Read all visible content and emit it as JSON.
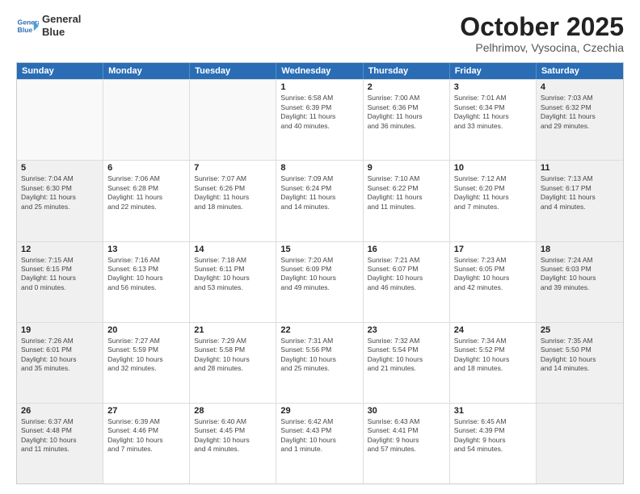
{
  "header": {
    "logo_line1": "General",
    "logo_line2": "Blue",
    "month": "October 2025",
    "location": "Pelhrimov, Vysocina, Czechia"
  },
  "weekdays": [
    "Sunday",
    "Monday",
    "Tuesday",
    "Wednesday",
    "Thursday",
    "Friday",
    "Saturday"
  ],
  "rows": [
    [
      {
        "day": "",
        "text": "",
        "empty": true
      },
      {
        "day": "",
        "text": "",
        "empty": true
      },
      {
        "day": "",
        "text": "",
        "empty": true
      },
      {
        "day": "1",
        "text": "Sunrise: 6:58 AM\nSunset: 6:39 PM\nDaylight: 11 hours\nand 40 minutes."
      },
      {
        "day": "2",
        "text": "Sunrise: 7:00 AM\nSunset: 6:36 PM\nDaylight: 11 hours\nand 36 minutes."
      },
      {
        "day": "3",
        "text": "Sunrise: 7:01 AM\nSunset: 6:34 PM\nDaylight: 11 hours\nand 33 minutes."
      },
      {
        "day": "4",
        "text": "Sunrise: 7:03 AM\nSunset: 6:32 PM\nDaylight: 11 hours\nand 29 minutes.",
        "shaded": true
      }
    ],
    [
      {
        "day": "5",
        "text": "Sunrise: 7:04 AM\nSunset: 6:30 PM\nDaylight: 11 hours\nand 25 minutes.",
        "shaded": true
      },
      {
        "day": "6",
        "text": "Sunrise: 7:06 AM\nSunset: 6:28 PM\nDaylight: 11 hours\nand 22 minutes."
      },
      {
        "day": "7",
        "text": "Sunrise: 7:07 AM\nSunset: 6:26 PM\nDaylight: 11 hours\nand 18 minutes."
      },
      {
        "day": "8",
        "text": "Sunrise: 7:09 AM\nSunset: 6:24 PM\nDaylight: 11 hours\nand 14 minutes."
      },
      {
        "day": "9",
        "text": "Sunrise: 7:10 AM\nSunset: 6:22 PM\nDaylight: 11 hours\nand 11 minutes."
      },
      {
        "day": "10",
        "text": "Sunrise: 7:12 AM\nSunset: 6:20 PM\nDaylight: 11 hours\nand 7 minutes."
      },
      {
        "day": "11",
        "text": "Sunrise: 7:13 AM\nSunset: 6:17 PM\nDaylight: 11 hours\nand 4 minutes.",
        "shaded": true
      }
    ],
    [
      {
        "day": "12",
        "text": "Sunrise: 7:15 AM\nSunset: 6:15 PM\nDaylight: 11 hours\nand 0 minutes.",
        "shaded": true
      },
      {
        "day": "13",
        "text": "Sunrise: 7:16 AM\nSunset: 6:13 PM\nDaylight: 10 hours\nand 56 minutes."
      },
      {
        "day": "14",
        "text": "Sunrise: 7:18 AM\nSunset: 6:11 PM\nDaylight: 10 hours\nand 53 minutes."
      },
      {
        "day": "15",
        "text": "Sunrise: 7:20 AM\nSunset: 6:09 PM\nDaylight: 10 hours\nand 49 minutes."
      },
      {
        "day": "16",
        "text": "Sunrise: 7:21 AM\nSunset: 6:07 PM\nDaylight: 10 hours\nand 46 minutes."
      },
      {
        "day": "17",
        "text": "Sunrise: 7:23 AM\nSunset: 6:05 PM\nDaylight: 10 hours\nand 42 minutes."
      },
      {
        "day": "18",
        "text": "Sunrise: 7:24 AM\nSunset: 6:03 PM\nDaylight: 10 hours\nand 39 minutes.",
        "shaded": true
      }
    ],
    [
      {
        "day": "19",
        "text": "Sunrise: 7:26 AM\nSunset: 6:01 PM\nDaylight: 10 hours\nand 35 minutes.",
        "shaded": true
      },
      {
        "day": "20",
        "text": "Sunrise: 7:27 AM\nSunset: 5:59 PM\nDaylight: 10 hours\nand 32 minutes."
      },
      {
        "day": "21",
        "text": "Sunrise: 7:29 AM\nSunset: 5:58 PM\nDaylight: 10 hours\nand 28 minutes."
      },
      {
        "day": "22",
        "text": "Sunrise: 7:31 AM\nSunset: 5:56 PM\nDaylight: 10 hours\nand 25 minutes."
      },
      {
        "day": "23",
        "text": "Sunrise: 7:32 AM\nSunset: 5:54 PM\nDaylight: 10 hours\nand 21 minutes."
      },
      {
        "day": "24",
        "text": "Sunrise: 7:34 AM\nSunset: 5:52 PM\nDaylight: 10 hours\nand 18 minutes."
      },
      {
        "day": "25",
        "text": "Sunrise: 7:35 AM\nSunset: 5:50 PM\nDaylight: 10 hours\nand 14 minutes.",
        "shaded": true
      }
    ],
    [
      {
        "day": "26",
        "text": "Sunrise: 6:37 AM\nSunset: 4:48 PM\nDaylight: 10 hours\nand 11 minutes.",
        "shaded": true
      },
      {
        "day": "27",
        "text": "Sunrise: 6:39 AM\nSunset: 4:46 PM\nDaylight: 10 hours\nand 7 minutes."
      },
      {
        "day": "28",
        "text": "Sunrise: 6:40 AM\nSunset: 4:45 PM\nDaylight: 10 hours\nand 4 minutes."
      },
      {
        "day": "29",
        "text": "Sunrise: 6:42 AM\nSunset: 4:43 PM\nDaylight: 10 hours\nand 1 minute."
      },
      {
        "day": "30",
        "text": "Sunrise: 6:43 AM\nSunset: 4:41 PM\nDaylight: 9 hours\nand 57 minutes."
      },
      {
        "day": "31",
        "text": "Sunrise: 6:45 AM\nSunset: 4:39 PM\nDaylight: 9 hours\nand 54 minutes."
      },
      {
        "day": "",
        "text": "",
        "empty": true,
        "shaded": true
      }
    ]
  ]
}
